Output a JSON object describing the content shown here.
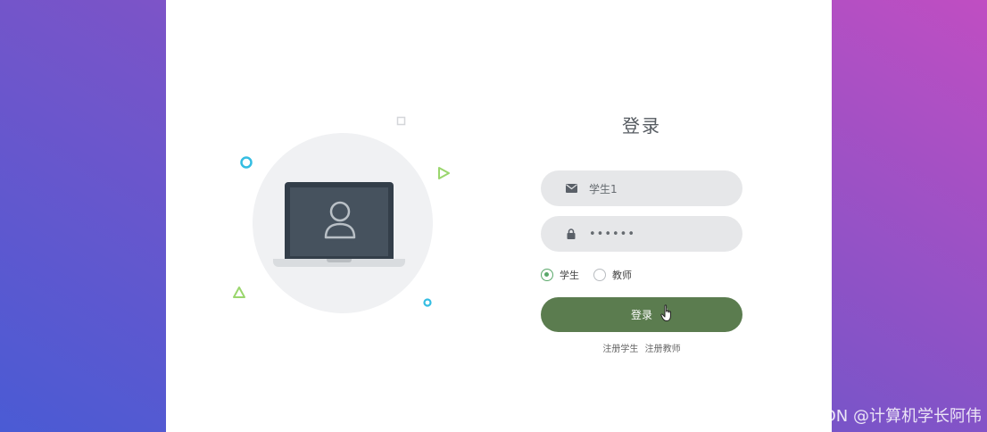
{
  "login": {
    "title": "登录",
    "username": "学生1",
    "password": "••••••",
    "roles": [
      {
        "label": "学生",
        "checked": true
      },
      {
        "label": "教师",
        "checked": false
      }
    ],
    "submit_label": "登录",
    "links": [
      "注册学生",
      "注册教师"
    ]
  },
  "icons": {
    "username": "envelope-icon",
    "password": "lock-icon",
    "avatar": "user-icon",
    "cursor": "hand-pointer-icon"
  },
  "colors": {
    "button": "#5b7c4f",
    "radio_active": "#5aa86a",
    "accent_cyan": "#34bde2",
    "accent_green": "#9ad66d"
  },
  "watermark": "CSDN @计算机学长阿伟"
}
